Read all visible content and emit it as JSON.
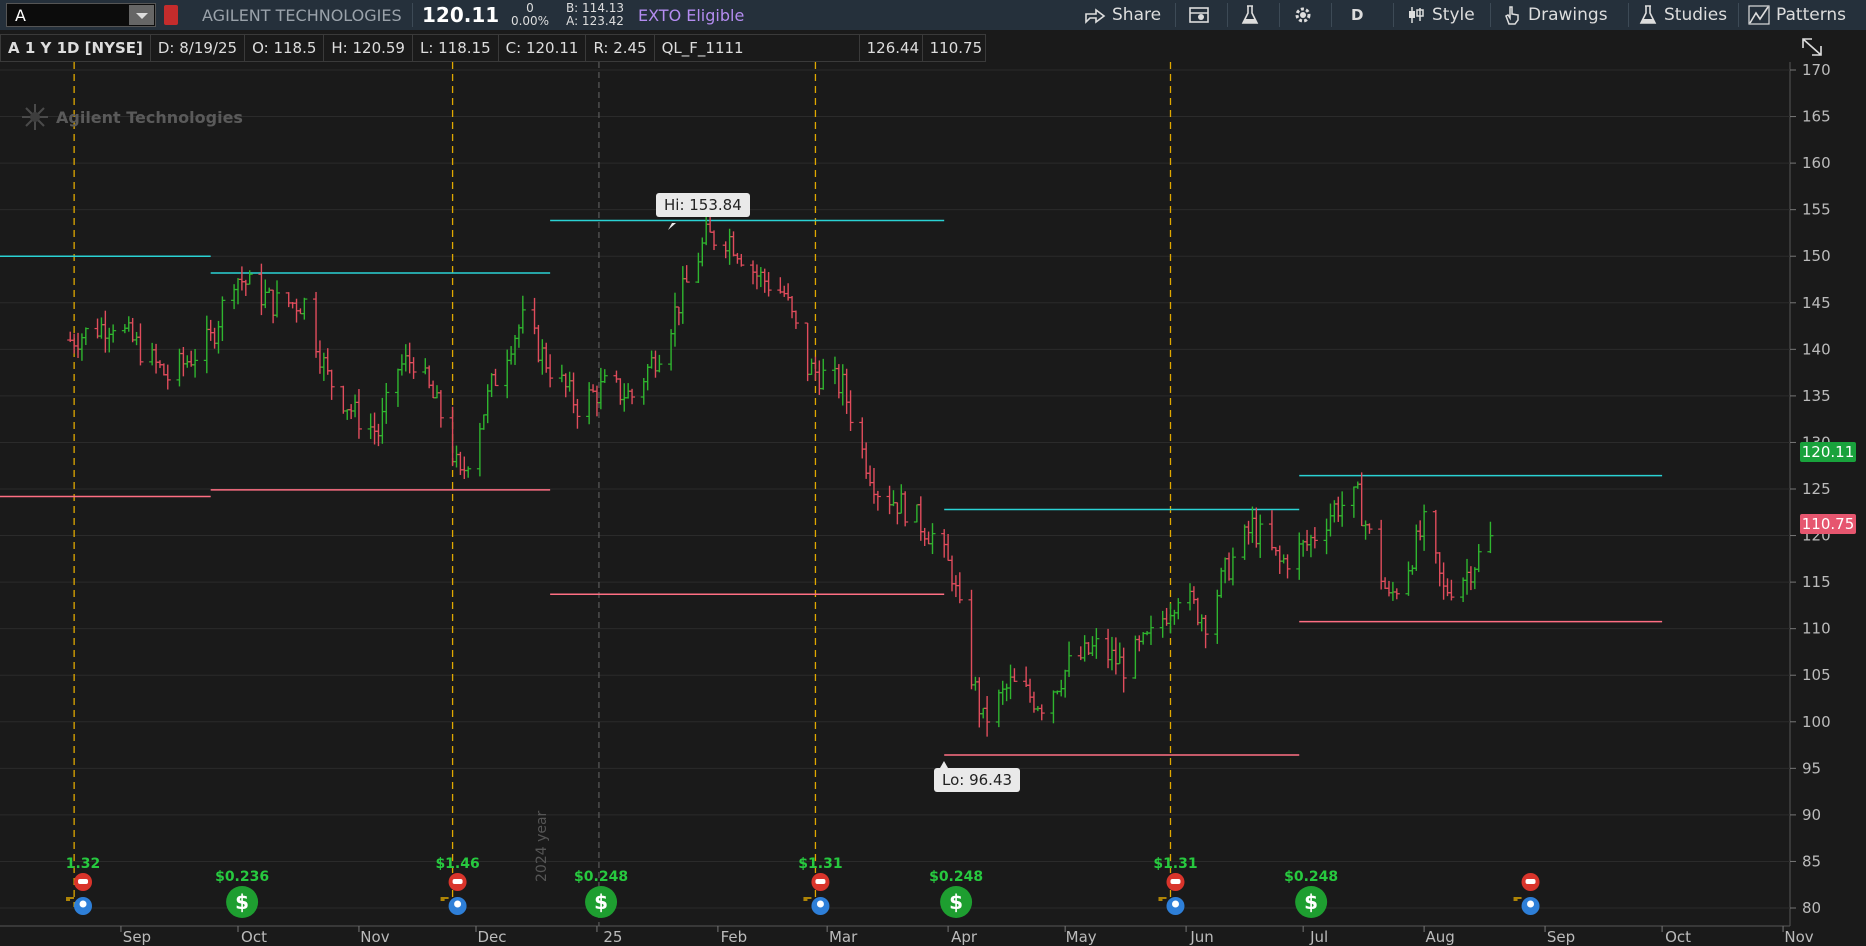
{
  "toolbar": {
    "symbol_value": "A",
    "company": "AGILENT TECHNOLOGIES",
    "last": "120.11",
    "net_change": "0",
    "pct_change": "0.00%",
    "bid": "B: 114.13",
    "ask": "A: 123.42",
    "exto": "EXTO Eligible",
    "share_label": "Share",
    "timeframe_label": "D",
    "style_label": "Style",
    "drawings_label": "Drawings",
    "studies_label": "Studies",
    "patterns_label": "Patterns",
    "icons": [
      "symbol-link-icon",
      "share-icon",
      "calendar-icon",
      "flask-icon",
      "gear-icon",
      "candle-style-icon",
      "hand-drawings-icon",
      "studies-flask-icon",
      "patterns-icon"
    ]
  },
  "infobar": {
    "symbol": "A 1 Y 1D [NYSE]",
    "date": "D: 8/19/25",
    "open": "O: 118.5",
    "high": "H: 120.59",
    "low": "L: 118.15",
    "close": "C: 120.11",
    "range": "R: 2.45",
    "study": "QL_F_1111",
    "study_hi": "126.44",
    "study_lo": "110.75"
  },
  "chart_data": {
    "type": "ohlc-bar",
    "watermark": "Agilent Technologies",
    "colors": {
      "up": "#2fb52f",
      "down": "#e04c5c",
      "cyan": "#2ad2d4",
      "pink": "#ff6f83",
      "grid": "#2b2b2b",
      "event": "#e0a800"
    },
    "y_axis": {
      "min": 80,
      "max": 170,
      "ticks": [
        "170",
        "165",
        "160",
        "155",
        "150",
        "145",
        "140",
        "135",
        "130",
        "125",
        "120",
        "115",
        "110",
        "105",
        "100",
        "95",
        "90",
        "85",
        "80"
      ]
    },
    "x_axis": {
      "labels": [
        "Sep",
        "Oct",
        "Nov",
        "Dec",
        "25",
        "Feb",
        "Mar",
        "Apr",
        "May",
        "Jun",
        "Jul",
        "Aug",
        "Sep",
        "Oct",
        "Nov"
      ]
    },
    "last_price": "120.11",
    "low_line": "110.75",
    "high_note": "Hi: 153.84",
    "low_note": "Lo: 96.43",
    "year_label": "2024 year",
    "quarters": [
      {
        "hi": 150.0,
        "lo": 124.2
      },
      {
        "hi": 148.2,
        "lo": 124.9
      },
      {
        "hi": 153.84,
        "lo": 113.7
      },
      {
        "hi": 122.8,
        "lo": 96.43
      },
      {
        "hi": 126.44,
        "lo": 110.75
      }
    ],
    "price_path": [
      {
        "d": "2024-08-19",
        "p": 141
      },
      {
        "d": "2024-08-30",
        "p": 143
      },
      {
        "d": "2024-09-13",
        "p": 137
      },
      {
        "d": "2024-09-24",
        "p": 141
      },
      {
        "d": "2024-09-30",
        "p": 148
      },
      {
        "d": "2024-10-10",
        "p": 145
      },
      {
        "d": "2024-10-18",
        "p": 145
      },
      {
        "d": "2024-10-24",
        "p": 137
      },
      {
        "d": "2024-10-31",
        "p": 133
      },
      {
        "d": "2024-11-06",
        "p": 131
      },
      {
        "d": "2024-11-11",
        "p": 138
      },
      {
        "d": "2024-11-15",
        "p": 139
      },
      {
        "d": "2024-11-22",
        "p": 133
      },
      {
        "d": "2024-11-27",
        "p": 126
      },
      {
        "d": "2024-12-05",
        "p": 136
      },
      {
        "d": "2024-12-10",
        "p": 141
      },
      {
        "d": "2024-12-13",
        "p": 143
      },
      {
        "d": "2024-12-20",
        "p": 138
      },
      {
        "d": "2024-12-27",
        "p": 134
      },
      {
        "d": "2025-01-03",
        "p": 136
      },
      {
        "d": "2025-01-10",
        "p": 135
      },
      {
        "d": "2025-01-17",
        "p": 140
      },
      {
        "d": "2025-01-24",
        "p": 147
      },
      {
        "d": "2025-01-29",
        "p": 152
      },
      {
        "d": "2025-02-04",
        "p": 152
      },
      {
        "d": "2025-02-11",
        "p": 148
      },
      {
        "d": "2025-02-18",
        "p": 146
      },
      {
        "d": "2025-02-24",
        "p": 138
      },
      {
        "d": "2025-03-05",
        "p": 136
      },
      {
        "d": "2025-03-10",
        "p": 129
      },
      {
        "d": "2025-03-14",
        "p": 125
      },
      {
        "d": "2025-03-21",
        "p": 123
      },
      {
        "d": "2025-03-28",
        "p": 120
      },
      {
        "d": "2025-04-02",
        "p": 116
      },
      {
        "d": "2025-04-07",
        "p": 105
      },
      {
        "d": "2025-04-10",
        "p": 100
      },
      {
        "d": "2025-04-17",
        "p": 104
      },
      {
        "d": "2025-04-25",
        "p": 102
      },
      {
        "d": "2025-05-02",
        "p": 106
      },
      {
        "d": "2025-05-09",
        "p": 108
      },
      {
        "d": "2025-05-16",
        "p": 106
      },
      {
        "d": "2025-05-23",
        "p": 109
      },
      {
        "d": "2025-05-30",
        "p": 114
      },
      {
        "d": "2025-06-06",
        "p": 111
      },
      {
        "d": "2025-06-11",
        "p": 116
      },
      {
        "d": "2025-06-18",
        "p": 121
      },
      {
        "d": "2025-06-25",
        "p": 117
      },
      {
        "d": "2025-07-02",
        "p": 119
      },
      {
        "d": "2025-07-09",
        "p": 123
      },
      {
        "d": "2025-07-15",
        "p": 124
      },
      {
        "d": "2025-07-23",
        "p": 113
      },
      {
        "d": "2025-07-28",
        "p": 117
      },
      {
        "d": "2025-08-01",
        "p": 121
      },
      {
        "d": "2025-08-06",
        "p": 114
      },
      {
        "d": "2025-08-12",
        "p": 116
      },
      {
        "d": "2025-08-19",
        "p": 120.11
      }
    ],
    "events": [
      {
        "label": "1.32",
        "type": "earnings",
        "d": "2024-08-21"
      },
      {
        "label": "$0.236",
        "type": "dividend",
        "d": "2024-09-30"
      },
      {
        "label": "$1.46",
        "type": "earnings",
        "d": "2024-11-25"
      },
      {
        "label": "$0.248",
        "type": "dividend",
        "d": "2024-12-31"
      },
      {
        "label": "$1.31",
        "type": "earnings",
        "d": "2025-02-26"
      },
      {
        "label": "$0.248",
        "type": "dividend",
        "d": "2025-04-01"
      },
      {
        "label": "$1.31",
        "type": "earnings",
        "d": "2025-05-28"
      },
      {
        "label": "$0.248",
        "type": "dividend",
        "d": "2025-07-01"
      },
      {
        "label": "",
        "type": "earnings",
        "d": "2025-08-27"
      }
    ]
  }
}
